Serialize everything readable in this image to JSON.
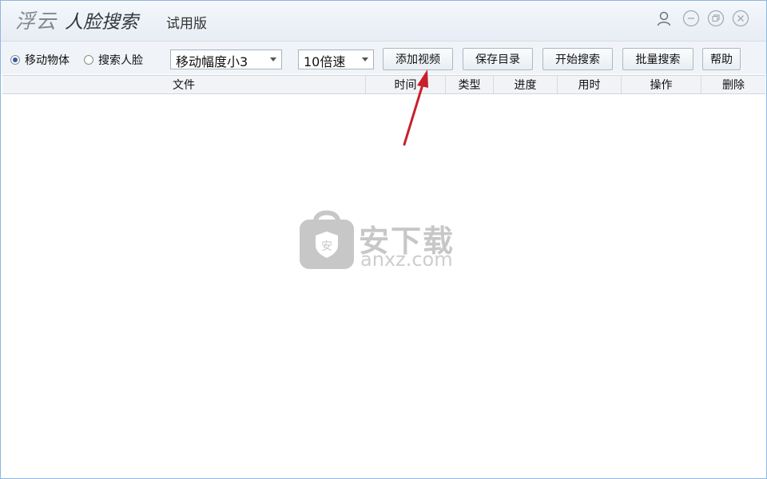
{
  "titlebar": {
    "brand": "浮云",
    "app_name": "人脸搜索",
    "edition": "试用版",
    "icons": [
      "user-icon",
      "minimize-icon",
      "restore-icon",
      "close-icon"
    ]
  },
  "toolbar": {
    "radio_options": [
      {
        "label": "移动物体",
        "selected": true
      },
      {
        "label": "搜索人脸",
        "selected": false
      }
    ],
    "sensitivity_select": "移动幅度小3",
    "speed_select": "10倍速",
    "buttons": {
      "add_video": "添加视频",
      "save_dir": "保存目录",
      "start_search": "开始搜索",
      "batch_search": "批量搜索",
      "help": "帮助"
    }
  },
  "table": {
    "columns": [
      "文件",
      "时间",
      "类型",
      "进度",
      "用时",
      "操作",
      "删除"
    ],
    "rows": []
  },
  "watermark": {
    "logo_text": "安下载",
    "url": "anxz.com"
  },
  "colors": {
    "accent": "#2b5fa6",
    "annotation_arrow": "#c8202a"
  }
}
